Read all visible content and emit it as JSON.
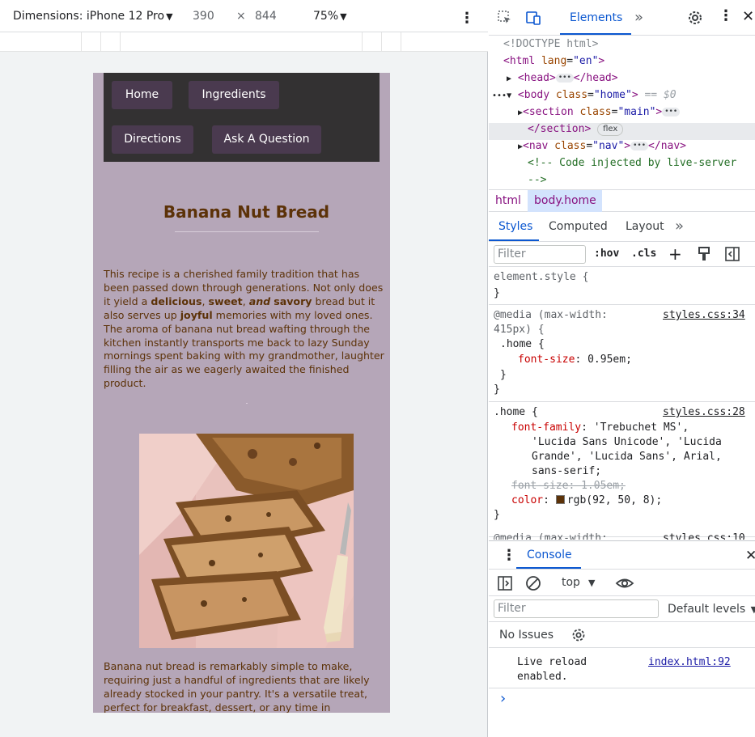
{
  "device_toolbar": {
    "device": "Dimensions: iPhone 12 Pro",
    "width": "390",
    "times": "×",
    "height": "844",
    "zoom": "75%"
  },
  "site": {
    "nav": [
      "Home",
      "Ingredients",
      "Directions",
      "Ask A Question"
    ],
    "heading": "Banana Nut Bread",
    "para1": {
      "t1": "This recipe is a cherished family tradition that has been passed down through generations. Not only does it yield a ",
      "b1": "delicious",
      "t2": ", ",
      "b2": "sweet",
      "t3": ", ",
      "bi": "and",
      "t4": " ",
      "b3": "savory",
      "t5": " bread but it also serves up ",
      "b4": "joyful",
      "t6": " memories with my loved ones. The aroma of banana nut bread wafting through the kitchen instantly transports me back to lazy Sunday mornings spent baking with my grandmother, laughter filling the air as we eagerly awaited the finished product."
    },
    "para2": "Banana nut bread is remarkably simple to make, requiring just a handful of ingredients that are likely already stocked in your pantry. It's a versatile treat, perfect for breakfast, dessert, or any time in"
  },
  "devtools": {
    "tabs": {
      "elements": "Elements",
      "more": "»"
    },
    "dom": {
      "doctype": "<!DOCTYPE html>",
      "html_open": "<html",
      "lang_attr": "lang",
      "lang_val": "\"en\"",
      "close_gt": ">",
      "head": "<head>",
      "head_close": "</head>",
      "body_open": "<body",
      "class_attr": "class",
      "body_class": "\"home\"",
      "eq0": "== $0",
      "section_open": "<section",
      "section_class": "\"main\"",
      "section_close": "</section>",
      "flex": "flex",
      "nav_open": "<nav",
      "nav_class": "\"nav\"",
      "nav_close": "</nav>",
      "comment1": "<!-- Code injected by live-server",
      "comment2": "-->"
    },
    "breadcrumbs": [
      "html",
      "body.home"
    ],
    "styles_tabs": [
      "Styles",
      "Computed",
      "Layout"
    ],
    "filter_placeholder": "Filter",
    "hov": ":hov",
    "cls": ".cls",
    "rules": {
      "element_style": "element.style {",
      "close_brace": "}",
      "media1_line1": "@media (max-width:",
      "media1_line2": "415px) {",
      "media1_link": "styles.css:34",
      "home_selector": ".home {",
      "font_size_prop": "font-size",
      "font_size_val": "0.95em;",
      "home2_link": "styles.css:28",
      "font_family_prop": "font-family",
      "ff1": "'Trebuchet MS',",
      "ff2": "'Lucida Sans Unicode', 'Lucida",
      "ff3": "Grande', 'Lucida Sans', Arial,",
      "ff4": "sans-serif;",
      "font_size_struck": "font-size: 1.05em;",
      "color_prop": "color",
      "color_val": "rgb(92, 50, 8);",
      "media2_line1": "@media (max-width:",
      "media2_link": "styles.css:10"
    },
    "console": {
      "title": "Console",
      "context": "top",
      "filter_placeholder": "Filter",
      "levels": "Default levels",
      "no_issues": "No Issues",
      "message_line1": "Live reload",
      "message_line2": "enabled.",
      "message_source": "index.html:92",
      "prompt": "›"
    }
  },
  "colors": {
    "page_bg": "#b5a6b8",
    "nav_bg": "#333132",
    "nav_btn": "#4a3a4f",
    "text_brown": "#5c3208",
    "accent_blue": "#0b57d0"
  }
}
